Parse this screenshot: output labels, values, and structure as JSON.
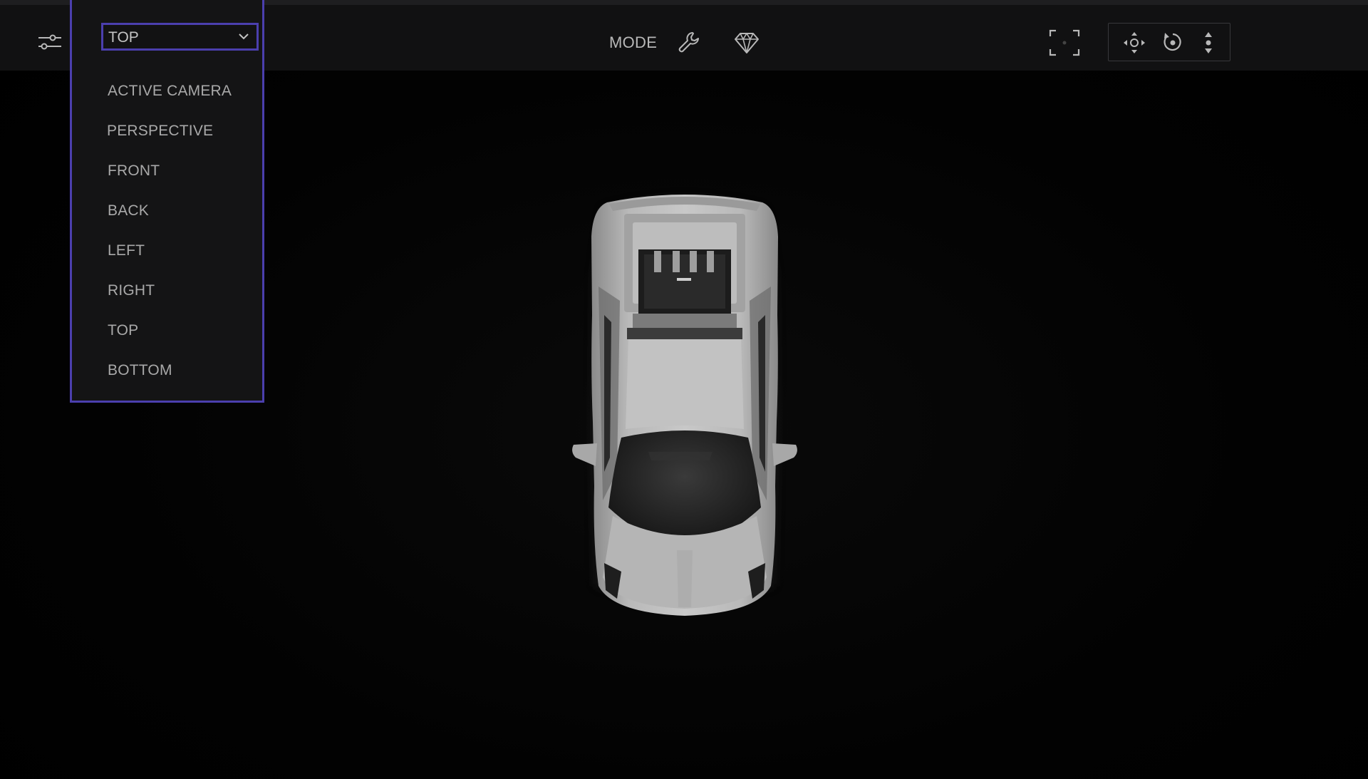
{
  "toolbar": {
    "mode_label": "MODE",
    "icons": {
      "settings": "sliders-icon",
      "mode_tools": "wrench-icon",
      "mode_material": "gem-icon",
      "frame": "focus-frame-icon",
      "pan": "pan-arrows-icon",
      "orbit": "orbit-icon",
      "zoom": "zoom-arrows-icon"
    }
  },
  "view_select": {
    "selected": "TOP",
    "options": [
      "ACTIVE CAMERA",
      "PERSPECTIVE",
      "FRONT",
      "BACK",
      "LEFT",
      "RIGHT",
      "TOP",
      "BOTTOM"
    ]
  },
  "colors": {
    "accent": "#4b3fae",
    "toolbar_bg": "#111112",
    "viewport_bg": "#000000",
    "text": "#b8b8b8"
  }
}
